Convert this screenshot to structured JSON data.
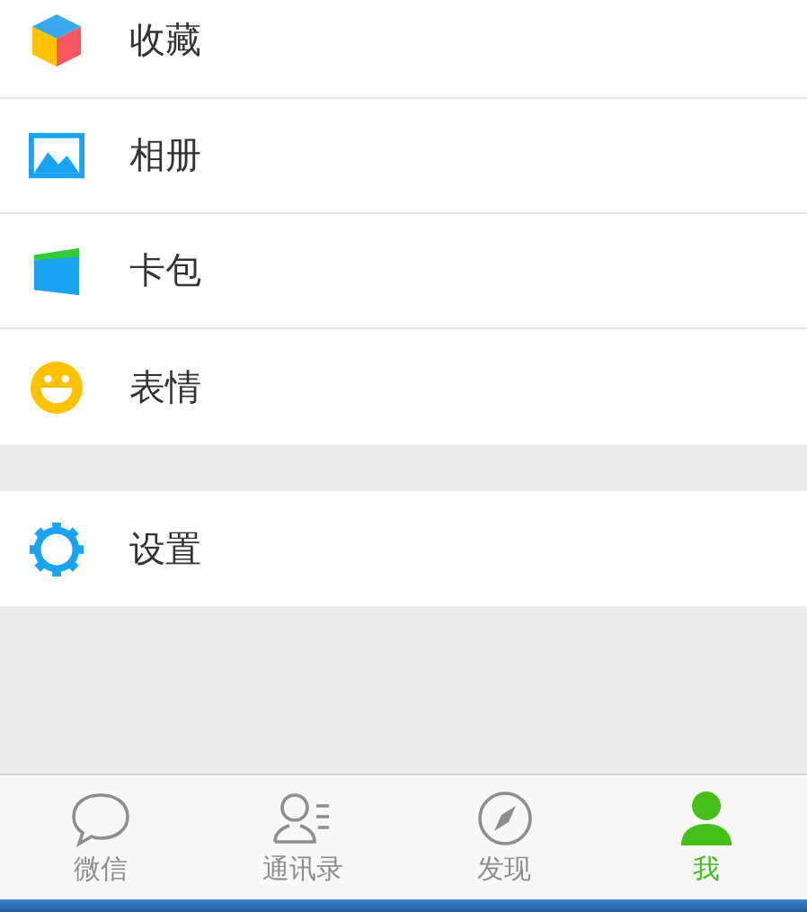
{
  "menu_groups": [
    {
      "items": [
        {
          "kind": "favorites",
          "label": "收藏"
        },
        {
          "kind": "album",
          "label": "相册"
        },
        {
          "kind": "wallet",
          "label": "卡包"
        },
        {
          "kind": "stickers",
          "label": "表情"
        }
      ]
    },
    {
      "items": [
        {
          "kind": "settings",
          "label": "设置"
        }
      ]
    }
  ],
  "tab_bar": {
    "tabs": [
      {
        "kind": "chats",
        "label": "微信",
        "selected": false
      },
      {
        "kind": "contacts",
        "label": "通讯录",
        "selected": false
      },
      {
        "kind": "discover",
        "label": "发现",
        "selected": false
      },
      {
        "kind": "me",
        "label": "我",
        "selected": true
      }
    ]
  }
}
